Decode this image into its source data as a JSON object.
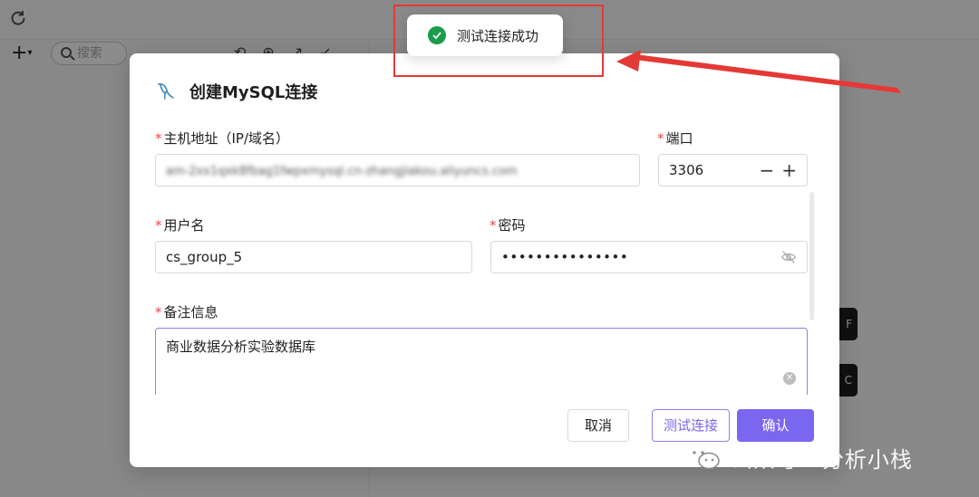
{
  "background": {
    "search_placeholder": "搜索",
    "dark_button_1": "F",
    "dark_button_2": "C"
  },
  "dialog": {
    "title": "创建MySQL连接",
    "fields": {
      "host": {
        "label": "主机地址（IP/域名）",
        "value": "am-2xx1qxk8fbag1fwpxmysql.cn-zhangjiakou.aliyuncs.com"
      },
      "port": {
        "label": "端口",
        "value": "3306",
        "decrement": "−",
        "increment": "+"
      },
      "username": {
        "label": "用户名",
        "value": "cs_group_5"
      },
      "password": {
        "label": "密码",
        "value": "•••••••••••••••"
      },
      "remark": {
        "label": "备注信息",
        "value": "商业数据分析实验数据库"
      }
    },
    "required_mark": "*",
    "buttons": {
      "cancel": "取消",
      "test": "测试连接",
      "confirm": "确认"
    }
  },
  "toast": {
    "message": "测试连接成功"
  },
  "watermark": {
    "text": "公众号 · 分析小栈"
  },
  "colors": {
    "primary": "#7b66f0",
    "success": "#1a9d4b",
    "annotation": "#e53935",
    "required": "#e5484d"
  }
}
